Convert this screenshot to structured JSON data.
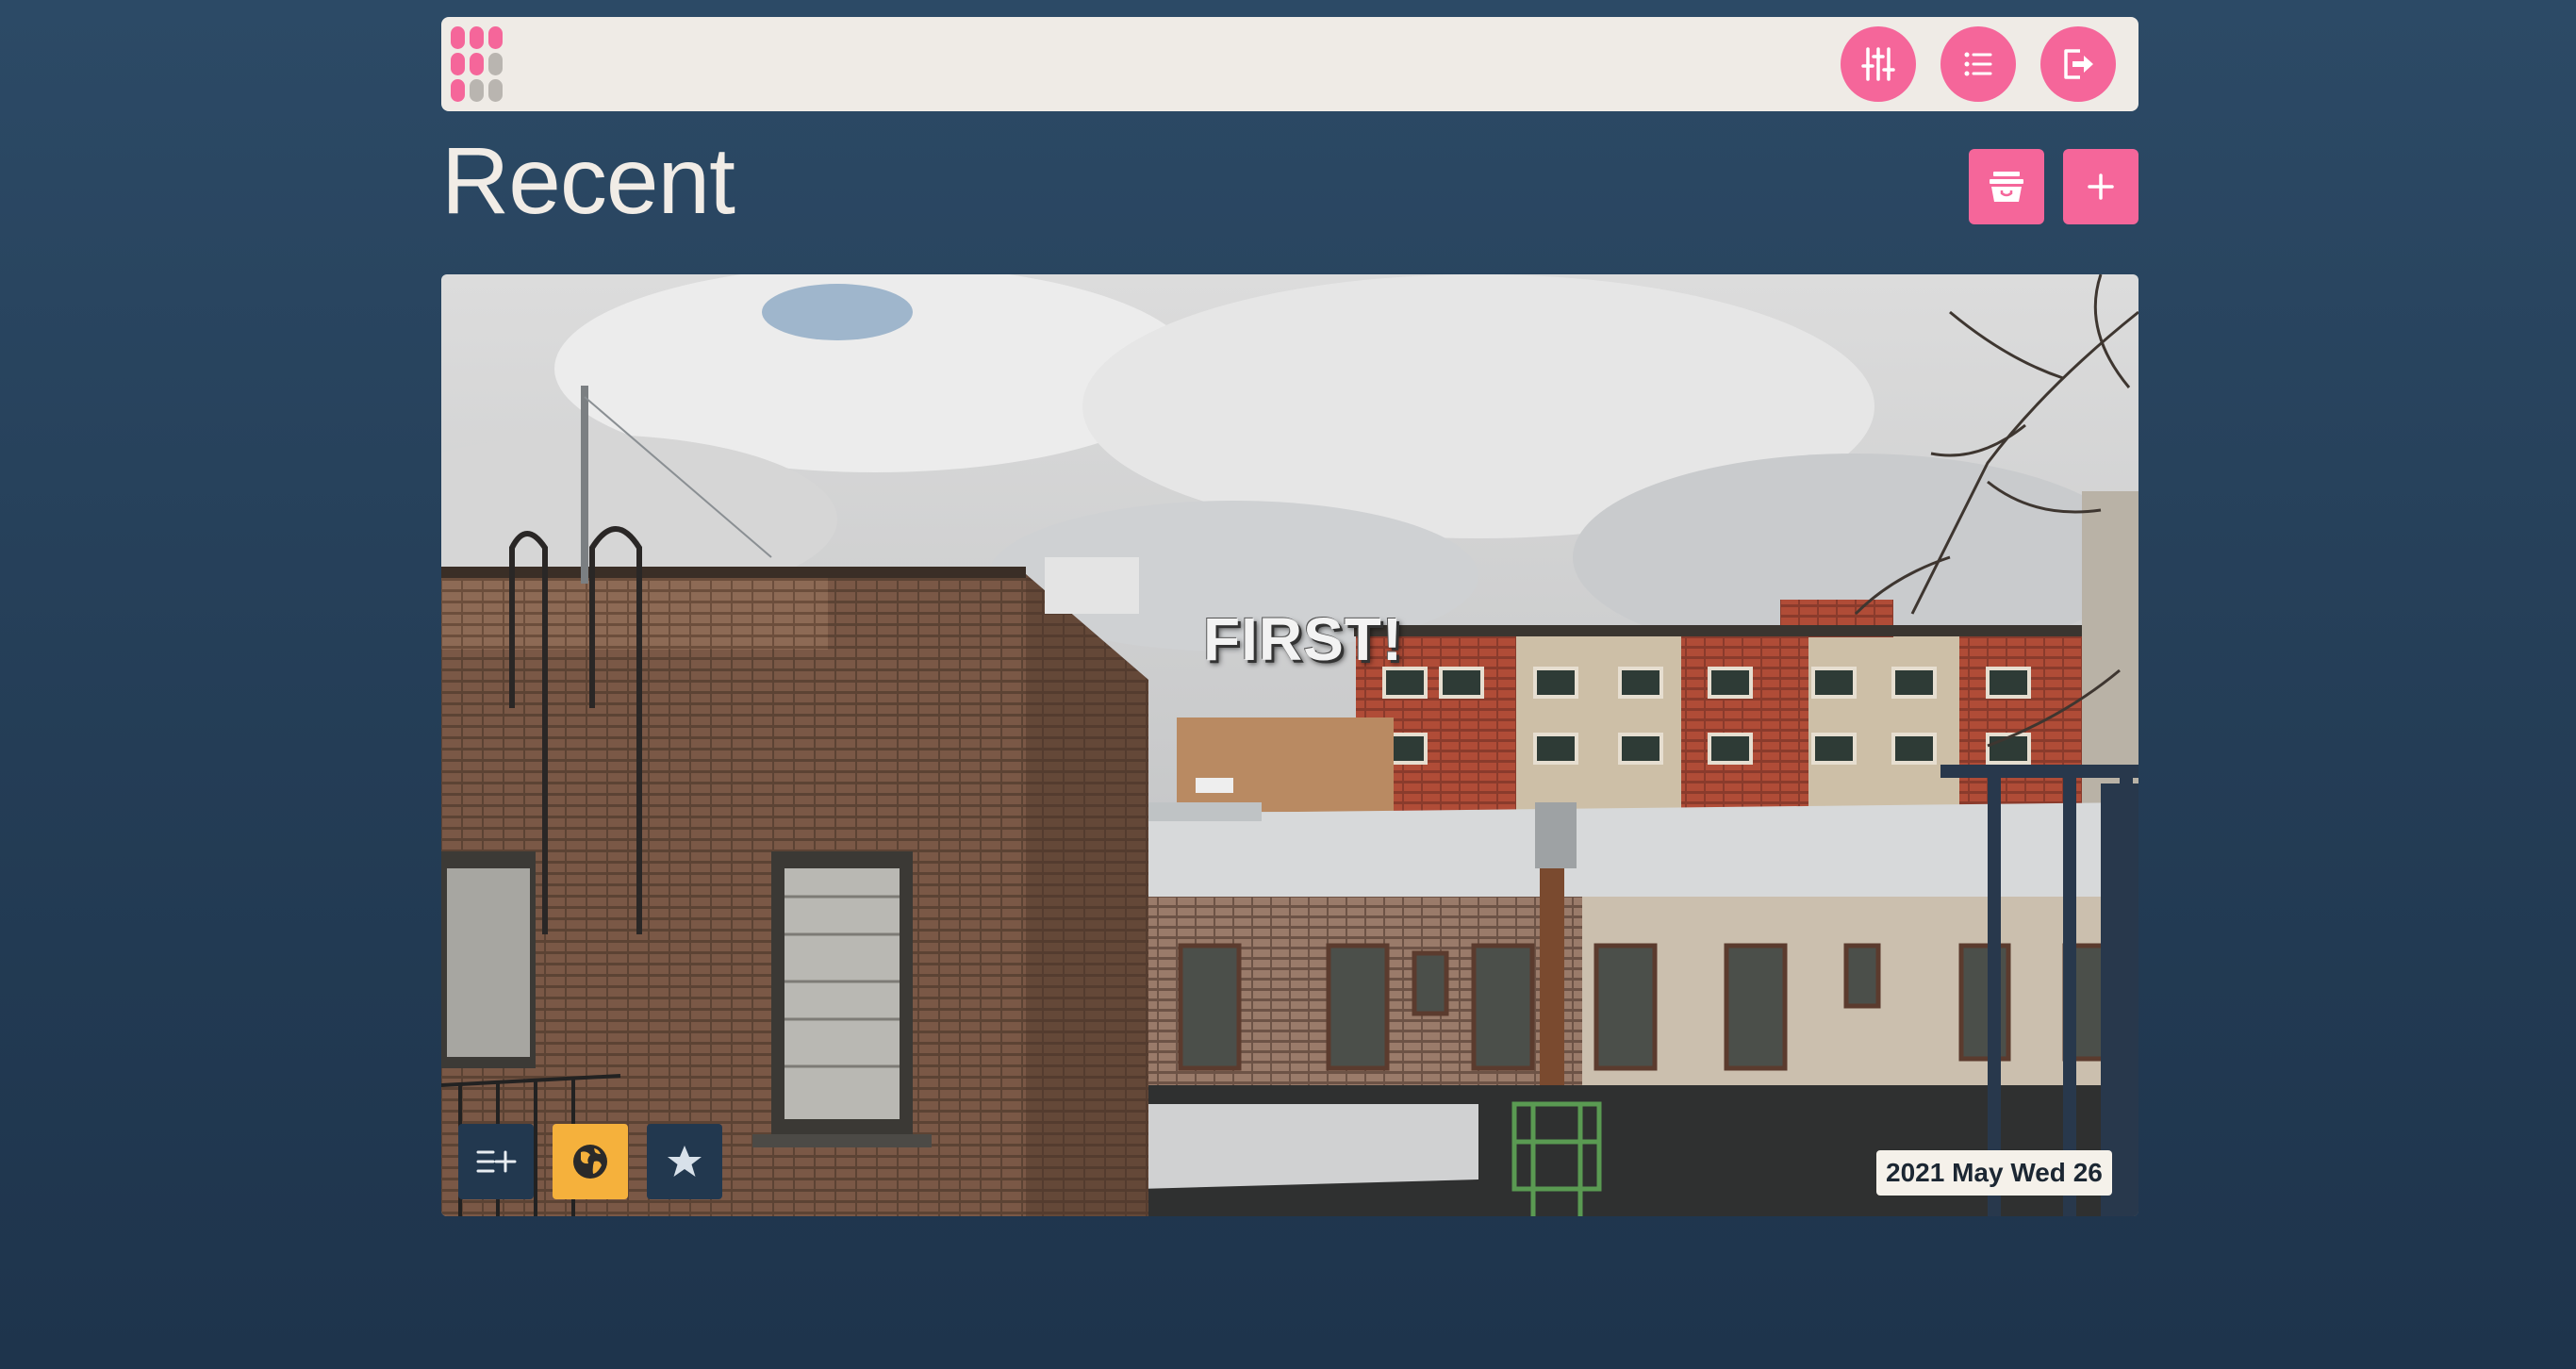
{
  "page": {
    "title": "Recent",
    "colors": {
      "accent": "#f5669a",
      "background": "#2c4a66",
      "topbar": "#efebe6",
      "gold": "#f5b13c",
      "dark_button": "#22384f"
    }
  },
  "topbar": {
    "logo_icon": "app-grid-logo",
    "buttons": [
      {
        "icon": "sliders-icon"
      },
      {
        "icon": "list-icon"
      },
      {
        "icon": "logout-icon"
      }
    ]
  },
  "header_actions": [
    {
      "icon": "basket-icon"
    },
    {
      "icon": "plus-icon"
    }
  ],
  "post": {
    "overlay_text": "FIRST!",
    "date": "2021 May Wed 26",
    "actions": [
      {
        "icon": "add-to-list-icon",
        "color": "#22384f"
      },
      {
        "icon": "globe-icon",
        "color": "#f5b13c"
      },
      {
        "icon": "star-icon",
        "color": "#22384f"
      }
    ]
  }
}
